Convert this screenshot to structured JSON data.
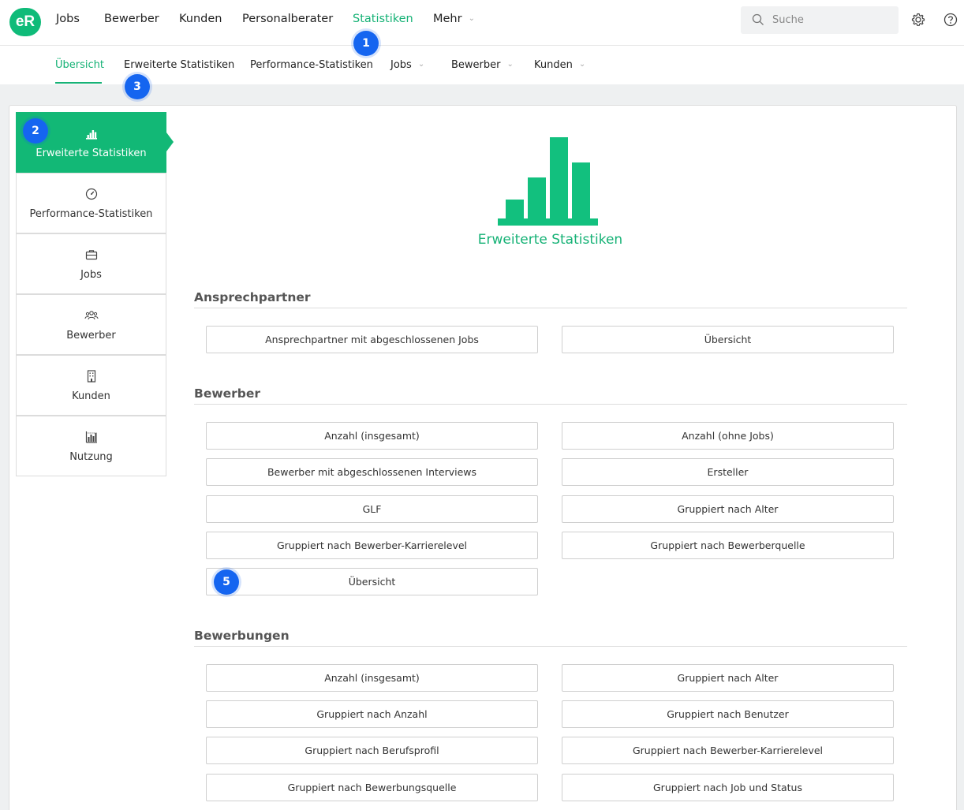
{
  "app": {
    "logo_text": "eR"
  },
  "topnav": {
    "items": [
      "Jobs",
      "Bewerber",
      "Kunden",
      "Personalberater",
      "Statistiken",
      "Mehr"
    ],
    "active": "Statistiken",
    "search_placeholder": "Suche"
  },
  "subnav": {
    "items": [
      "Übersicht",
      "Erweiterte Statistiken",
      "Performance-Statistiken",
      "Jobs",
      "Bewerber",
      "Kunden"
    ],
    "active": "Übersicht"
  },
  "sidebar": {
    "items": [
      {
        "label": "Erweiterte Statistiken",
        "icon": "bar-chart-icon",
        "active": true
      },
      {
        "label": "Performance-Statistiken",
        "icon": "gauge-icon"
      },
      {
        "label": "Jobs",
        "icon": "briefcase-icon"
      },
      {
        "label": "Bewerber",
        "icon": "people-icon"
      },
      {
        "label": "Kunden",
        "icon": "building-icon"
      },
      {
        "label": "Nutzung",
        "icon": "usage-chart-icon"
      }
    ]
  },
  "hero": {
    "title": "Erweiterte Statistiken",
    "icon": "bar-chart-icon"
  },
  "sections": [
    {
      "title": "Ansprechpartner",
      "buttons": [
        "Ansprechpartner mit abgeschlossenen Jobs",
        "Übersicht"
      ]
    },
    {
      "title": "Bewerber",
      "buttons": [
        "Anzahl (insgesamt)",
        "Anzahl (ohne Jobs)",
        "Bewerber mit abgeschlossenen Interviews",
        "Ersteller",
        "GLF",
        "Gruppiert nach Alter",
        "Gruppiert nach Bewerber-Karrierelevel",
        "Gruppiert nach Bewerberquelle",
        "Übersicht"
      ]
    },
    {
      "title": "Bewerbungen",
      "buttons": [
        "Anzahl (insgesamt)",
        "Gruppiert nach Alter",
        "Gruppiert nach Anzahl",
        "Gruppiert nach Benutzer",
        "Gruppiert nach Berufsprofil",
        "Gruppiert nach Bewerber-Karrierelevel",
        "Gruppiert nach Bewerbungsquelle",
        "Gruppiert nach Job und Status"
      ]
    }
  ],
  "annotations": [
    "1",
    "2",
    "3",
    "5"
  ],
  "colors": {
    "accent": "#16b276",
    "badge": "#1565f0"
  }
}
